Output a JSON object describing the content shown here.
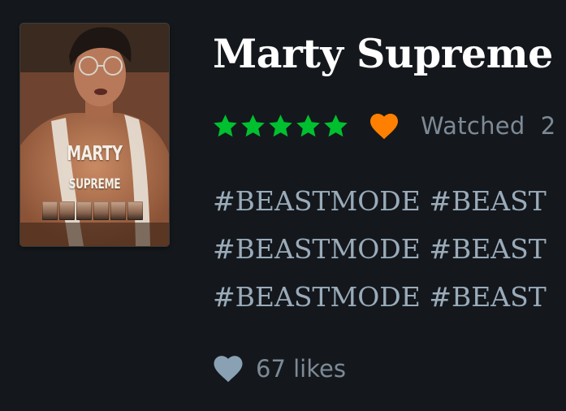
{
  "film": {
    "title": "Marty Supreme",
    "poster": {
      "title_line1": "MARTY",
      "title_line2": "SUPREME"
    }
  },
  "rating": {
    "stars": 5,
    "max_stars": 5,
    "star_color": "#00c030",
    "liked": true,
    "liked_color": "#ff8000"
  },
  "watched_label": "Watched",
  "watched_date_partial": "2",
  "review": {
    "lines": [
      "#BEASTMODE #BEAST",
      "#BEASTMODE #BEAST",
      "#BEASTMODE #BEAST"
    ]
  },
  "likes": {
    "count_text": "67 likes",
    "icon": "heart-icon",
    "icon_color": "#8aa1b4"
  }
}
